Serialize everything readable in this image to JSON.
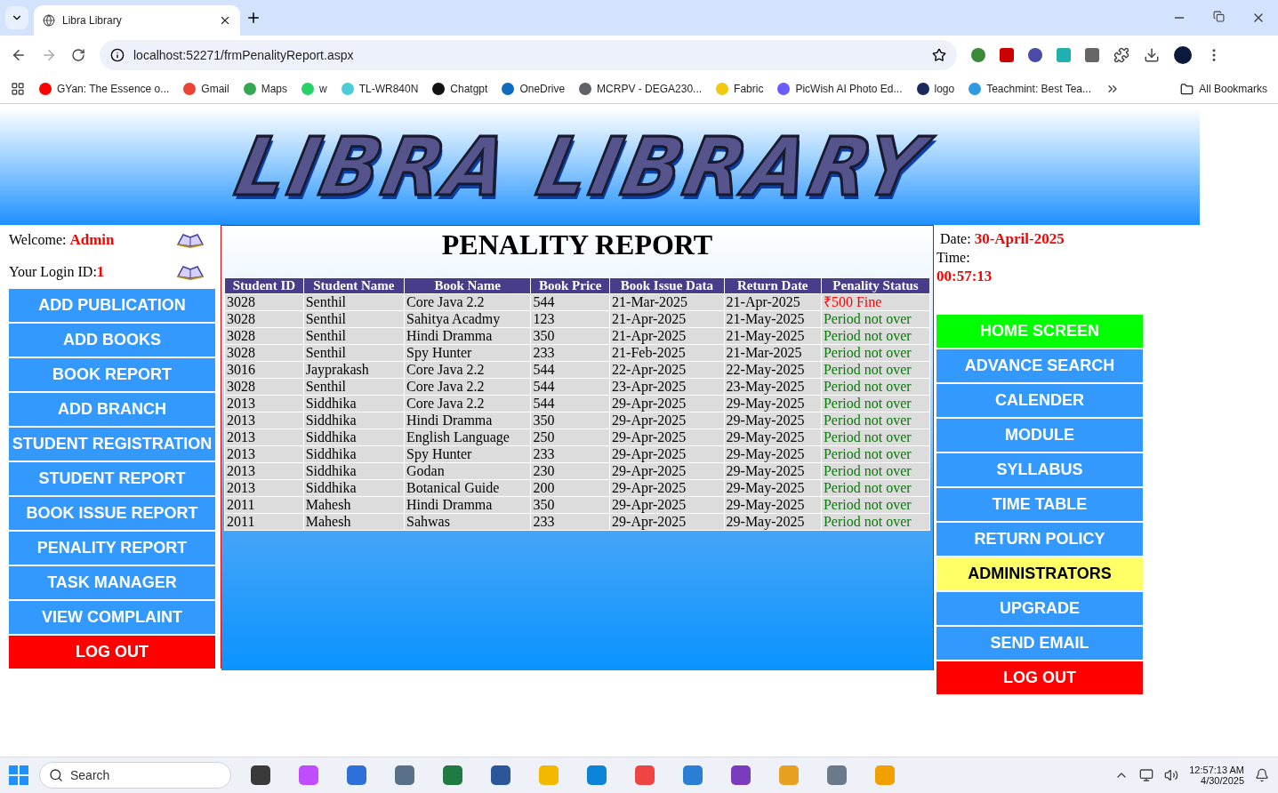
{
  "browser": {
    "tab_title": "Libra Library",
    "url": "localhost:52271/frmPenalityReport.aspx",
    "bookmarks": [
      {
        "label": "GYan: The Essence o...",
        "color": "#ff0000"
      },
      {
        "label": "Gmail",
        "color": "#ea4335"
      },
      {
        "label": "Maps",
        "color": "#34a853"
      },
      {
        "label": "w",
        "color": "#25d366"
      },
      {
        "label": "TL-WR840N",
        "color": "#4acbd6"
      },
      {
        "label": "Chatgpt",
        "color": "#111111"
      },
      {
        "label": "OneDrive",
        "color": "#0f6cbd"
      },
      {
        "label": "MCRPV - DEGA230...",
        "color": "#5f6368"
      },
      {
        "label": "Fabric",
        "color": "#f2c811"
      },
      {
        "label": "PicWish AI Photo Ed...",
        "color": "#6a5cff"
      },
      {
        "label": "logo",
        "color": "#1a2a5a"
      },
      {
        "label": "Teachmint: Best Tea...",
        "color": "#2e9be0"
      }
    ],
    "all_bookmarks": "All Bookmarks"
  },
  "header": {
    "logo_text": "LIBRA LIBRARY"
  },
  "left": {
    "welcome_label": "Welcome:",
    "user": "Admin",
    "login_label": "Your Login ID:",
    "login_id": "1",
    "menu": [
      {
        "label": "ADD PUBLICATION",
        "kind": "nav"
      },
      {
        "label": "ADD BOOKS",
        "kind": "nav"
      },
      {
        "label": "BOOK REPORT",
        "kind": "nav"
      },
      {
        "label": "ADD BRANCH",
        "kind": "nav"
      },
      {
        "label": "STUDENT REGISTRATION",
        "kind": "nav"
      },
      {
        "label": "STUDENT REPORT",
        "kind": "nav"
      },
      {
        "label": "BOOK ISSUE REPORT",
        "kind": "nav"
      },
      {
        "label": "PENALITY REPORT",
        "kind": "nav"
      },
      {
        "label": "TASK MANAGER",
        "kind": "nav"
      },
      {
        "label": "VIEW COMPLAINT",
        "kind": "nav"
      },
      {
        "label": "LOG OUT",
        "kind": "logout"
      }
    ]
  },
  "report": {
    "title": "PENALITY REPORT",
    "columns": [
      "Student ID",
      "Student Name",
      "Book Name",
      "Book Price",
      "Book Issue Data",
      "Return Date",
      "Penality Status"
    ],
    "rows": [
      {
        "cells": [
          "3028",
          "Senthil",
          "Core Java 2.2",
          "544",
          "21-Mar-2025",
          "21-Apr-2025"
        ],
        "status": "₹500 Fine",
        "fined": true
      },
      {
        "cells": [
          "3028",
          "Senthil",
          "Sahitya Acadmy",
          "123",
          "21-Apr-2025",
          "21-May-2025"
        ],
        "status": "Period not over",
        "fined": false
      },
      {
        "cells": [
          "3028",
          "Senthil",
          "Hindi Dramma",
          "350",
          "21-Apr-2025",
          "21-May-2025"
        ],
        "status": "Period not over",
        "fined": false
      },
      {
        "cells": [
          "3028",
          "Senthil",
          "Spy Hunter",
          "233",
          "21-Feb-2025",
          "21-Mar-2025"
        ],
        "status": "Period not over",
        "fined": false
      },
      {
        "cells": [
          "3016",
          "Jayprakash",
          "Core Java 2.2",
          "544",
          "22-Apr-2025",
          "22-May-2025"
        ],
        "status": "Period not over",
        "fined": false
      },
      {
        "cells": [
          "3028",
          "Senthil",
          "Core Java 2.2",
          "544",
          "23-Apr-2025",
          "23-May-2025"
        ],
        "status": "Period not over",
        "fined": false
      },
      {
        "cells": [
          "2013",
          "Siddhika",
          "Core Java 2.2",
          "544",
          "29-Apr-2025",
          "29-May-2025"
        ],
        "status": "Period not over",
        "fined": false
      },
      {
        "cells": [
          "2013",
          "Siddhika",
          "Hindi Dramma",
          "350",
          "29-Apr-2025",
          "29-May-2025"
        ],
        "status": "Period not over",
        "fined": false
      },
      {
        "cells": [
          "2013",
          "Siddhika",
          "English Language",
          "250",
          "29-Apr-2025",
          "29-May-2025"
        ],
        "status": "Period not over",
        "fined": false
      },
      {
        "cells": [
          "2013",
          "Siddhika",
          "Spy Hunter",
          "233",
          "29-Apr-2025",
          "29-May-2025"
        ],
        "status": "Period not over",
        "fined": false
      },
      {
        "cells": [
          "2013",
          "Siddhika",
          "Godan",
          "230",
          "29-Apr-2025",
          "29-May-2025"
        ],
        "status": "Period not over",
        "fined": false
      },
      {
        "cells": [
          "2013",
          "Siddhika",
          "Botanical Guide",
          "200",
          "29-Apr-2025",
          "29-May-2025"
        ],
        "status": "Period not over",
        "fined": false
      },
      {
        "cells": [
          "2011",
          "Mahesh",
          "Hindi Dramma",
          "350",
          "29-Apr-2025",
          "29-May-2025"
        ],
        "status": "Period not over",
        "fined": false
      },
      {
        "cells": [
          "2011",
          "Mahesh",
          "Sahwas",
          "233",
          "29-Apr-2025",
          "29-May-2025"
        ],
        "status": "Period not over",
        "fined": false
      }
    ]
  },
  "right": {
    "date_label": "Date:",
    "date": "30-April-2025",
    "time_label": "Time:",
    "time": "00:57:13",
    "menu": [
      {
        "label": "HOME SCREEN",
        "kind": "home"
      },
      {
        "label": "ADVANCE SEARCH",
        "kind": "nav"
      },
      {
        "label": "CALENDER",
        "kind": "nav"
      },
      {
        "label": "MODULE",
        "kind": "nav"
      },
      {
        "label": "SYLLABUS",
        "kind": "nav"
      },
      {
        "label": "TIME TABLE",
        "kind": "nav"
      },
      {
        "label": "RETURN POLICY",
        "kind": "nav"
      },
      {
        "label": "ADMINISTRATORS",
        "kind": "admin"
      },
      {
        "label": "UPGRADE",
        "kind": "nav"
      },
      {
        "label": "SEND EMAIL",
        "kind": "nav"
      },
      {
        "label": "LOG OUT",
        "kind": "logout"
      }
    ]
  },
  "taskbar": {
    "search_placeholder": "Search",
    "time": "12:57:13 AM",
    "date": "4/30/2025"
  }
}
